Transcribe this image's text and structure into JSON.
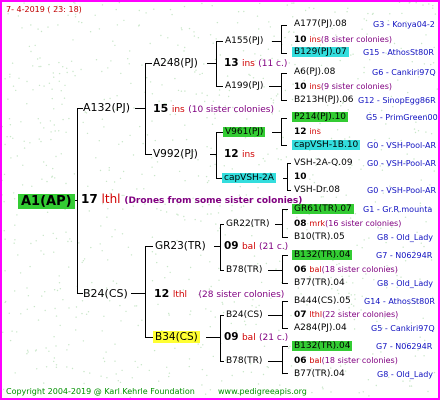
{
  "header": {
    "date": "7-  4-2019 (  23:  18)"
  },
  "footer": {
    "copyright": "Copyright 2004-2019 @ Karl Kehrle Foundation",
    "site": "www.pedigreeapis.org"
  },
  "root": {
    "label": "A1(AP)",
    "num": "17",
    "suffix": "lthl",
    "note": "(Drones from some sister colonies)"
  },
  "gen1": {
    "a132": {
      "label": "A132(PJ)",
      "num": "15",
      "suffix": "ins",
      "note": "(10 sister colonies)"
    },
    "b24": {
      "label": "B24(CS)",
      "num": "12",
      "suffix": "lthl",
      "note": "(28 sister colonies)"
    }
  },
  "gen2": {
    "a248": {
      "label": "A248(PJ)",
      "num": "13",
      "suffix": "ins",
      "note": "(11 c.)"
    },
    "v992": {
      "label": "V992(PJ)",
      "num": "12",
      "suffix": "ins"
    },
    "gr23": {
      "label": "GR23(TR)",
      "num": "09",
      "suffix": "bal",
      "note": "(21 c.)"
    },
    "b34": {
      "label": "B34(CS)",
      "num": "09",
      "suffix": "bal",
      "note": "(21 c.)"
    }
  },
  "gen3": {
    "a155": "A155(PJ)",
    "a199": "A199(PJ)",
    "v961": "V961(PJ)",
    "capvsh2a": "capVSH-2A",
    "gr22": "GR22(TR)",
    "b78a": "B78(TR)",
    "b24cs": "B24(CS)",
    "b78b": "B78(TR)"
  },
  "gen4": [
    {
      "label": "A177(PJ).08",
      "right": "G3 - Konya04-2"
    },
    {
      "num": "10",
      "suffix": "ins",
      "note": "(8 sister colonies)"
    },
    {
      "label": "B129(PJ).07",
      "right": "G15 - AthosSt80R"
    },
    {
      "label": "A6(PJ).08",
      "right": "G6 - Cankiri97Q"
    },
    {
      "num": "10",
      "suffix": "ins",
      "note": "(9 sister colonies)"
    },
    {
      "label": "B213H(PJ).06",
      "right": "G12 - SinopEgg86R"
    },
    {
      "label": "P214(PJ).10",
      "right": "G5 - PrimGreen00"
    },
    {
      "num": "12",
      "suffix": "ins"
    },
    {
      "label": "capVSH-1B.10",
      "right": "G0 - VSH-Pool-AR"
    },
    {
      "label": "VSH-2A-Q.09",
      "right": "G0 - VSH-Pool-AR"
    },
    {
      "num": "10"
    },
    {
      "label": "VSH-Dr.08",
      "right": "G0 - VSH-Pool-AR"
    },
    {
      "label": "GR61(TR).07",
      "right": "G1 - Gr.R.mounta"
    },
    {
      "num": "08",
      "suffix": "mrk",
      "note": "(16 sister colonies)"
    },
    {
      "label": "B10(TR).05",
      "right": "G8 - Old_Lady"
    },
    {
      "label": "B132(TR).04",
      "right": "G7 - N06294R"
    },
    {
      "num": "06",
      "suffix": "bal",
      "note": "(18 sister colonies)"
    },
    {
      "label": "B77(TR).04",
      "right": "G8 - Old_Lady"
    },
    {
      "label": "B444(CS).05",
      "right": "G14 - AthosSt80R"
    },
    {
      "num": "07",
      "suffix": "lthl",
      "note": "(22 sister colonies)"
    },
    {
      "label": "A284(PJ).04",
      "right": "G5 - Cankiri97Q"
    },
    {
      "label": "B132(TR).04",
      "right": "G7 - N06294R"
    },
    {
      "num": "06",
      "suffix": "bal",
      "note": "(18 sister colonies)"
    },
    {
      "label": "B77(TR).04",
      "right": "G8 - Old_Lady"
    }
  ],
  "colors": {
    "border": "#ff00ff",
    "green_hl": "#33cc33",
    "cyan_hl": "#33dddd",
    "yellow_hl": "#ffff33",
    "blue_text": "#1010c0",
    "red_text": "#c00000",
    "purple_text": "#800080",
    "footer_text": "#009000"
  }
}
